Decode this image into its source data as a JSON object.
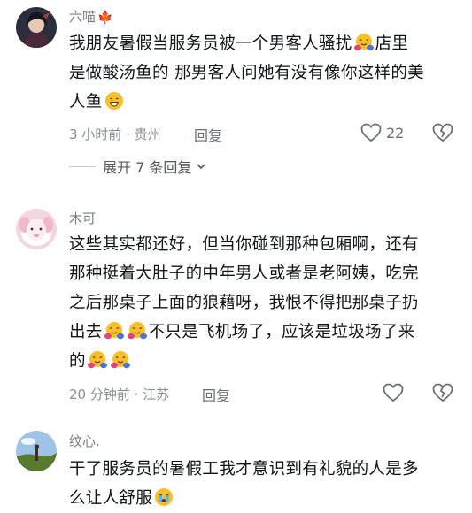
{
  "comments": [
    {
      "username": "六喵",
      "username_emoji": "🍁",
      "text_line1": "我朋友暑假当服务员被一个男客人骚扰",
      "text_line1_tail": "店里",
      "text_line2": "是做酸汤鱼的 那男客人问她有没有像你这样的美",
      "text_line3": "人鱼",
      "meta": "3 小时前 · 贵州",
      "reply": "回复",
      "likes": "22",
      "expand_label": "展开 7 条回复"
    },
    {
      "username": "木可",
      "text_line1": "这些其实都还好，但当你碰到那种包厢啊，还有",
      "text_line2": "那种挺着大肚子的中年男人或者是老阿姨，吃完",
      "text_line3": "之后那桌子上面的狼藉呀，我恨不得把那桌子扔",
      "text_line4_head": "出去",
      "text_line4_tail": "不只是飞机场了，应该是垃圾场了来",
      "text_line5": "的",
      "meta": "20 分钟前 · 江苏",
      "reply": "回复"
    },
    {
      "username": "纹心.",
      "text_line1": "干了服务员的暑假工我才意识到有礼貌的人是多",
      "text_line2": "么让人舒服"
    }
  ]
}
